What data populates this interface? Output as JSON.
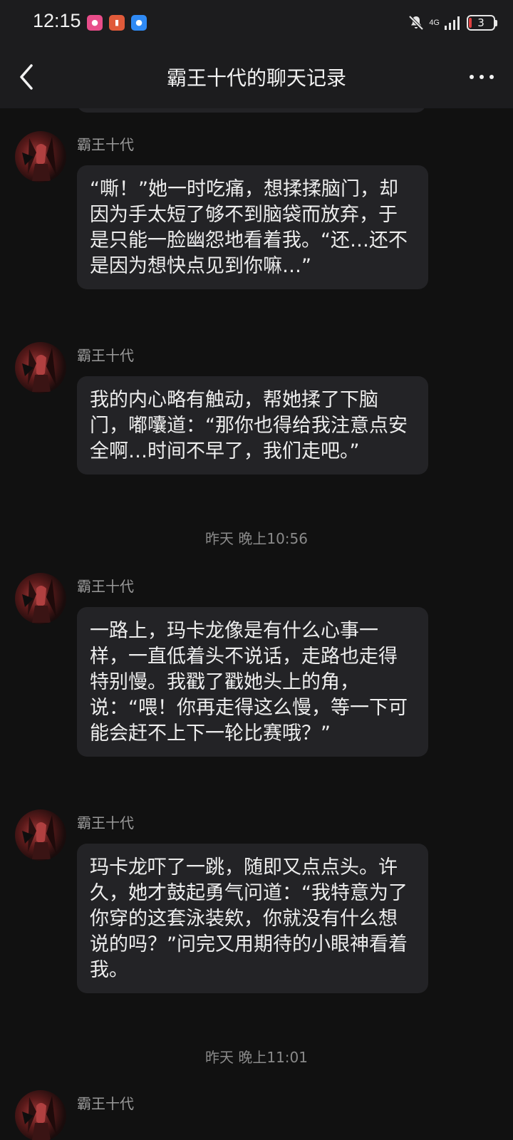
{
  "status_bar": {
    "time": "12:15",
    "network": "4G",
    "battery": "3",
    "icons": [
      "app-notification-icon",
      "app-notification-icon",
      "message-notification-icon",
      "mute-icon",
      "signal-icon",
      "battery-icon"
    ]
  },
  "header": {
    "title": "霸王十代的聊天记录",
    "back_icon": "chevron-left-icon",
    "more_icon": "more-dots-icon"
  },
  "messages": [
    {
      "sender": "霸王十代",
      "text": "“嘶！”她一时吃痛，想揉揉脑门，却因为手太短了够不到脑袋而放弃，于是只能一脸幽怨地看着我。“还…还不是因为想快点见到你嘛…”"
    },
    {
      "sender": "霸王十代",
      "text": "我的内心略有触动，帮她揉了下脑门，嘟囔道：“那你也得给我注意点安全啊…时间不早了，我们走吧。”"
    },
    {
      "sender": "霸王十代",
      "text": "一路上，玛卡龙像是有什么心事一样，一直低着头不说话，走路也走得特别慢。我戳了戳她头上的角，说：“喂！你再走得这么慢，等一下可能会赶不上下一轮比赛哦？”"
    },
    {
      "sender": "霸王十代",
      "text": "玛卡龙吓了一跳，随即又点点头。许久，她才鼓起勇气问道：“我特意为了你穿的这套泳装欸，你就没有什么想说的吗？”问完又用期待的小眼神看着我。"
    },
    {
      "sender": "霸王十代",
      "text": ""
    }
  ],
  "timestamps": [
    "昨天 晚上10:56",
    "昨天 晚上11:01"
  ]
}
